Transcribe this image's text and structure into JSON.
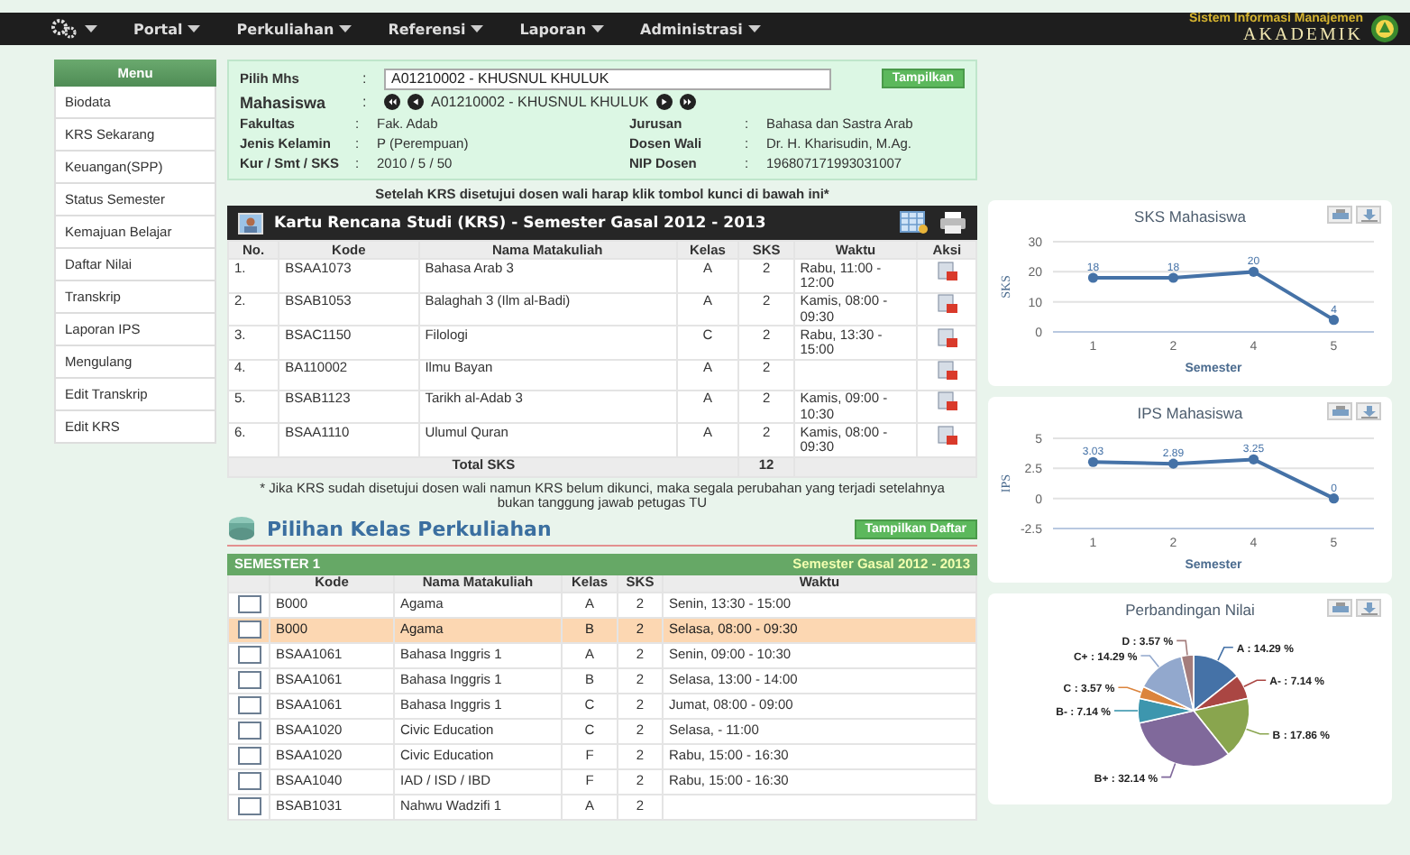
{
  "nav": {
    "items": [
      {
        "label": "Portal"
      },
      {
        "label": "Perkuliahan"
      },
      {
        "label": "Referensi"
      },
      {
        "label": "Laporan"
      },
      {
        "label": "Administrasi"
      }
    ],
    "brand": {
      "subtitle": "Sistem Informasi Manajemen",
      "title": "AKADEMIK"
    }
  },
  "sidebar": {
    "title": "Menu",
    "items": [
      "Biodata",
      "KRS Sekarang",
      "Keuangan(SPP)",
      "Status Semester",
      "Kemajuan Belajar",
      "Daftar Nilai",
      "Transkrip",
      "Laporan IPS",
      "Mengulang",
      "Edit Transkrip",
      "Edit KRS"
    ]
  },
  "student": {
    "select_label": "Pilih Mhs",
    "select_sep": ":",
    "select_value": "A01210002 - KHUSNUL KHULUK",
    "button": "Tampilkan",
    "mahasiswa": {
      "label": "Mahasiswa",
      "sep": ":",
      "value": "A01210002 - KHUSNUL KHULUK"
    },
    "details": [
      {
        "left": {
          "label": "Fakultas",
          "sep": ":",
          "value": "Fak. Adab"
        },
        "right": {
          "label": "Jurusan",
          "sep": ":",
          "value": "Bahasa dan Sastra Arab"
        }
      },
      {
        "left": {
          "label": "Jenis Kelamin",
          "sep": ":",
          "value": "P (Perempuan)"
        },
        "right": {
          "label": "Dosen Wali",
          "sep": ":",
          "value": "Dr. H. Kharisudin, M.Ag."
        }
      },
      {
        "left": {
          "label": "Kur / Smt / SKS",
          "sep": ":",
          "value": "2010 / 5 / 50"
        },
        "right": {
          "label": "NIP Dosen",
          "sep": ":",
          "value": "196807171993031007"
        }
      }
    ]
  },
  "note": "Setelah KRS disetujui dosen wali harap klik tombol kunci di bawah ini*",
  "krs": {
    "title": "Kartu Rencana Studi (KRS) - Semester Gasal 2012 - 2013",
    "columns": [
      "No.",
      "Kode",
      "Nama Matakuliah",
      "Kelas",
      "SKS",
      "Waktu",
      "Aksi"
    ],
    "rows": [
      {
        "no": "1.",
        "kode": "BSAA1073",
        "nama": "Bahasa Arab 3",
        "kelas": "A",
        "sks": "2",
        "waktu": "Rabu, 11:00 - 12:00"
      },
      {
        "no": "2.",
        "kode": "BSAB1053",
        "nama": "Balaghah 3 (Ilm al-Badi)",
        "kelas": "A",
        "sks": "2",
        "waktu": "Kamis, 08:00 - 09:30"
      },
      {
        "no": "3.",
        "kode": "BSAC1150",
        "nama": "Filologi",
        "kelas": "C",
        "sks": "2",
        "waktu": "Rabu, 13:30 - 15:00"
      },
      {
        "no": "4.",
        "kode": "BA110002",
        "nama": "Ilmu Bayan",
        "kelas": "A",
        "sks": "2"
      },
      {
        "no": "5.",
        "kode": "BSAB1123",
        "nama": "Tarikh al-Adab 3",
        "kelas": "A",
        "sks": "2",
        "waktu": "Kamis, 09:00 - 10:30"
      },
      {
        "no": "6.",
        "kode": "BSAA1110",
        "nama": "Ulumul Quran",
        "kelas": "A",
        "sks": "2",
        "waktu": "Kamis, 08:00 - 09:30"
      }
    ],
    "total_label": "Total SKS",
    "total": "12",
    "footnote": "* Jika KRS sudah disetujui dosen wali namun KRS belum dikunci, maka segala perubahan yang terjadi setelahnya bukan tanggung jawab petugas TU"
  },
  "pilihan": {
    "title": "Pilihan Kelas Perkuliahan",
    "button": "Tampilkan Daftar",
    "semester": "SEMESTER 1",
    "period": "Semester Gasal 2012 - 2013",
    "columns": [
      "Kode",
      "Nama Matakuliah",
      "Kelas",
      "SKS",
      "Waktu"
    ],
    "rows": [
      {
        "checked": false,
        "selected": false,
        "kode": "B000",
        "nama": "Agama",
        "kelas": "A",
        "sks": "2",
        "waktu": "Senin, 13:30 - 15:00"
      },
      {
        "checked": false,
        "selected": true,
        "kode": "B000",
        "nama": "Agama",
        "kelas": "B",
        "sks": "2",
        "waktu": "Selasa, 08:00 - 09:30"
      },
      {
        "checked": false,
        "selected": false,
        "kode": "BSAA1061",
        "nama": "Bahasa Inggris 1",
        "kelas": "A",
        "sks": "2",
        "waktu": "Senin, 09:00 - 10:30"
      },
      {
        "checked": false,
        "selected": false,
        "kode": "BSAA1061",
        "nama": "Bahasa Inggris 1",
        "kelas": "B",
        "sks": "2",
        "waktu": "Selasa, 13:00 - 14:00"
      },
      {
        "checked": false,
        "selected": false,
        "kode": "BSAA1061",
        "nama": "Bahasa Inggris 1",
        "kelas": "C",
        "sks": "2",
        "waktu": "Jumat, 08:00 - 09:00"
      },
      {
        "checked": false,
        "selected": false,
        "kode": "BSAA1020",
        "nama": "Civic Education",
        "kelas": "C",
        "sks": "2",
        "waktu": "Selasa, - 11:00"
      },
      {
        "checked": false,
        "selected": false,
        "kode": "BSAA1020",
        "nama": "Civic Education",
        "kelas": "F",
        "sks": "2",
        "waktu": "Rabu, 15:00 - 16:30"
      },
      {
        "checked": false,
        "selected": false,
        "kode": "BSAA1040",
        "nama": "IAD / ISD / IBD",
        "kelas": "F",
        "sks": "2",
        "waktu": "Rabu, 15:00 - 16:30"
      },
      {
        "checked": false,
        "selected": false,
        "kode": "BSAB1031",
        "nama": "Nahwu Wadzifi 1",
        "kelas": "A",
        "sks": "2"
      }
    ]
  },
  "charts": [
    {
      "chart_data": {
        "type": "line",
        "title": "SKS Mahasiswa",
        "xlabel": "Semester",
        "ylabel": "SKS",
        "categories": [
          "1",
          "2",
          "4",
          "5"
        ],
        "ylim": [
          0,
          30
        ],
        "yticks": [
          0,
          10,
          20,
          30
        ],
        "data_labels": true,
        "series": [
          {
            "color": "#4572a7",
            "marker": "circle",
            "values": [
              18,
              18,
              20,
              4
            ]
          }
        ]
      }
    },
    {
      "chart_data": {
        "type": "line",
        "title": "IPS Mahasiswa",
        "xlabel": "Semester",
        "ylabel": "IPS",
        "categories": [
          "1",
          "2",
          "4",
          "5"
        ],
        "ylim": [
          -2.5,
          5
        ],
        "yticks": [
          -2.5,
          0,
          2.5,
          5
        ],
        "data_labels": true,
        "series": [
          {
            "color": "#4572a7",
            "marker": "circle",
            "values": [
              3.03,
              2.89,
              3.25,
              0
            ]
          }
        ]
      }
    },
    {
      "chart_data": {
        "type": "pie",
        "title": "Perbandingan Nilai",
        "categories": [
          "A",
          "A-",
          "B",
          "B+",
          "B-",
          "C",
          "C+",
          "D"
        ],
        "values": [
          14.29,
          7.14,
          17.86,
          32.14,
          7.14,
          3.57,
          14.29,
          3.57
        ],
        "colors": [
          "#4572a7",
          "#aa4643",
          "#89a54e",
          "#80699b",
          "#3d96ae",
          "#db843d",
          "#92a8cd",
          "#a47d7c"
        ],
        "value_labels": [
          ": 14.29 %",
          ": 7.14 %",
          ": 17.86 %",
          ": 32.14 %",
          ": 7.14 %",
          ": 3.57 %",
          ": 14.29 %",
          ": 3.57 %"
        ]
      }
    }
  ]
}
